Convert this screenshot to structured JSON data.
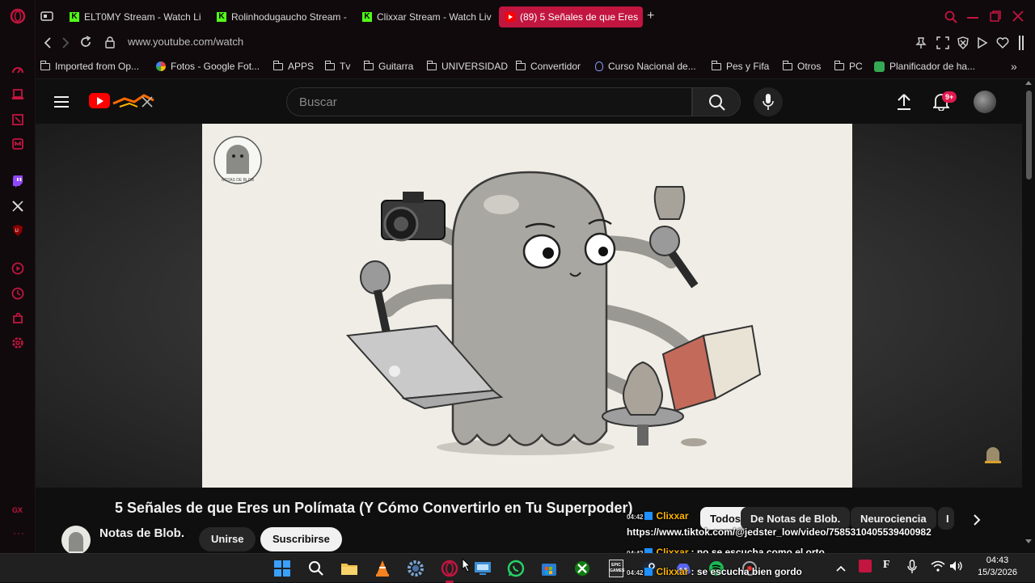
{
  "browser": {
    "tabs": [
      {
        "label": "ELT0MY Stream - Watch Li",
        "favicon": "kick-icon"
      },
      {
        "label": "Rolinhodugaucho Stream -",
        "favicon": "kick-icon"
      },
      {
        "label": "Clixxar Stream - Watch Liv",
        "favicon": "kick-icon"
      },
      {
        "label": "(89) 5 Señales de que Eres",
        "favicon": "youtube-icon",
        "active": true
      }
    ],
    "url": "www.youtube.com/watch",
    "bookmarks": [
      "Imported from Op...",
      "Fotos - Google Fot...",
      "APPS",
      "Tv",
      "Guitarra",
      "UNIVERSIDAD",
      "Convertidor",
      "Curso Nacional de...",
      "Pes y Fifa",
      "Otros",
      "PC",
      "Planificador de ha..."
    ],
    "accent": "#c2153f"
  },
  "youtube": {
    "search_placeholder": "Buscar",
    "notification_count": "9+",
    "channel_logo_text": "NOTAS DE BLOB",
    "video_title": "5 Señales de que Eres un Polímata (Y Cómo Convertirlo en Tu Superpoder)",
    "channel_name": "Notas de Blob.",
    "join_label": "Unirse",
    "subscribe_label": "Suscribirse",
    "chips": [
      "Todos",
      "De Notas de Blob.",
      "Neurociencia",
      "I"
    ]
  },
  "overlay_chat": [
    {
      "time": "04:42",
      "user": "Clixxar",
      "message": ""
    },
    {
      "time": "",
      "user": "",
      "message": "https://www.tiktok.com/@jedster_low/video/7585310405539400982"
    },
    {
      "time": "04:42",
      "user": "Clixxar",
      "message": ": no se escucha como el orto"
    },
    {
      "time": "04:42",
      "user": "Clixxar",
      "message": ": se escucha bien gordo"
    }
  ],
  "taskbar": {
    "time": "04:43",
    "date": "15/3/2026",
    "epic_label": "EPIC GAMES"
  },
  "sidebar": {
    "gx_label": "GX"
  }
}
